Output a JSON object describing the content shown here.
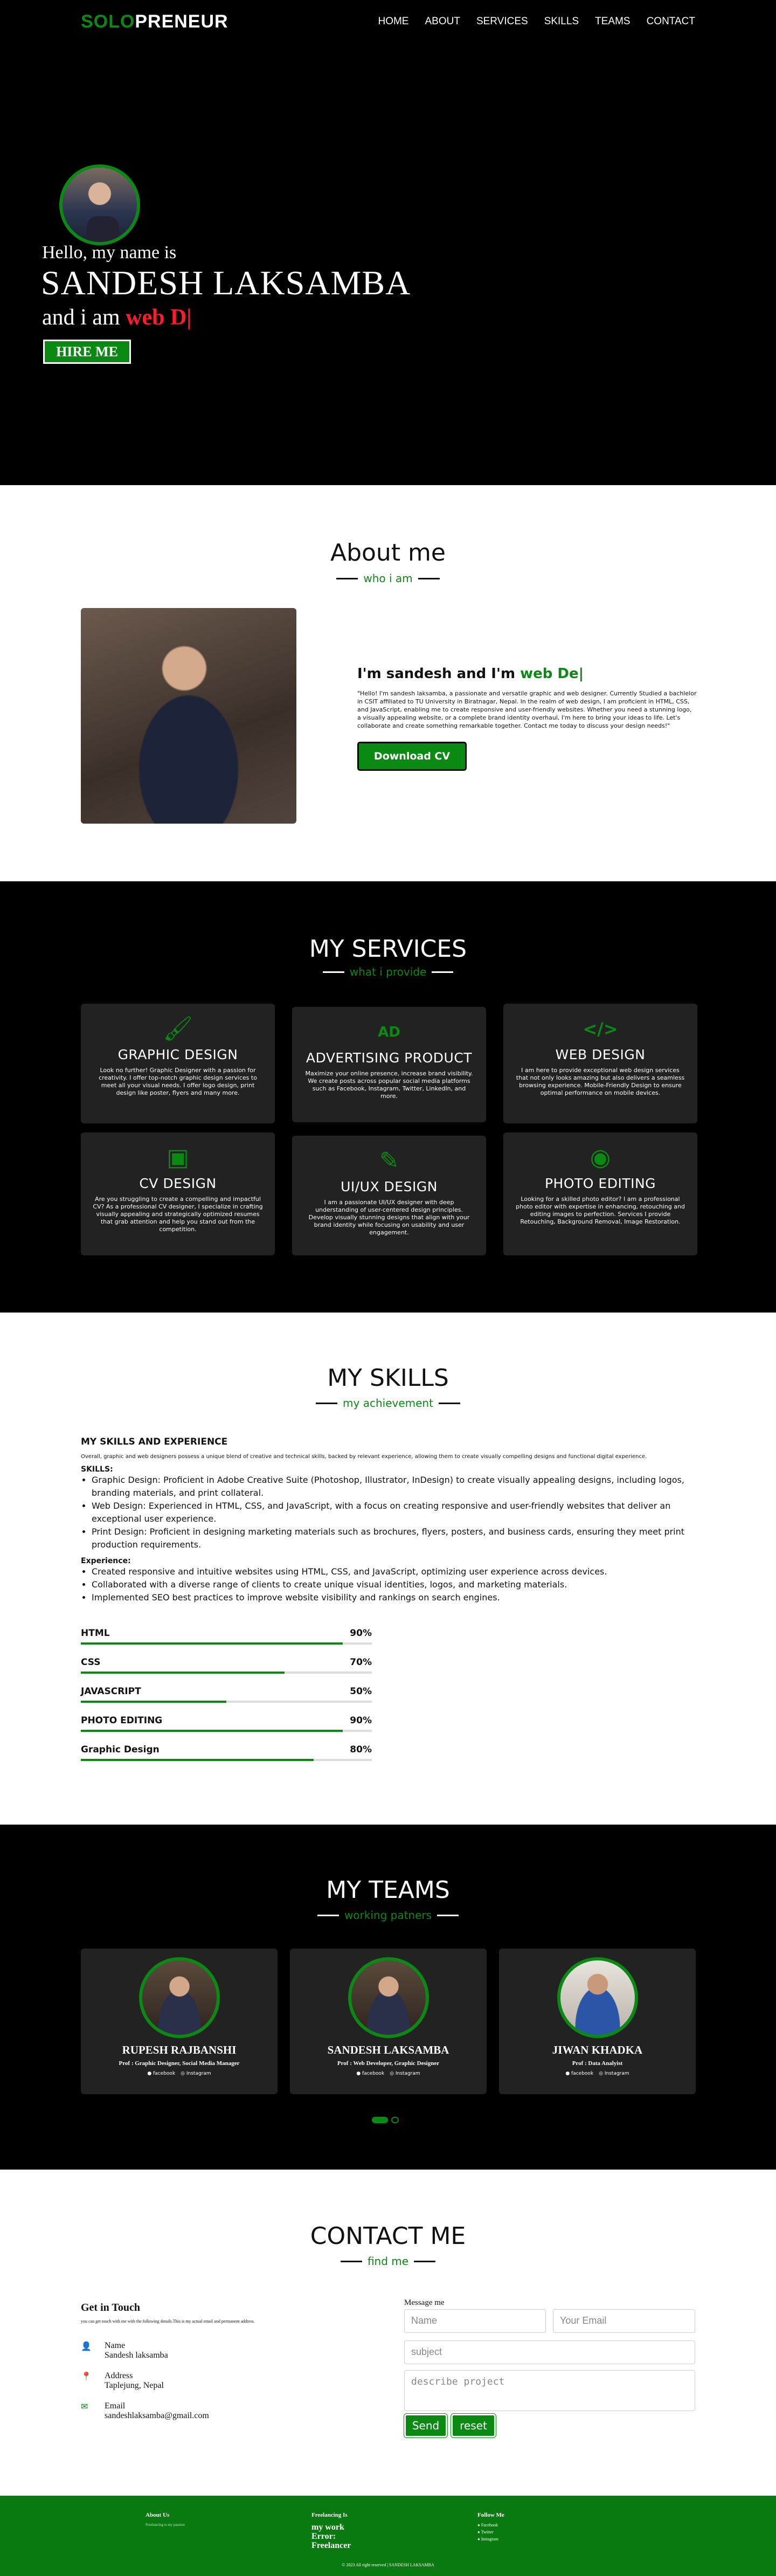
{
  "nav": {
    "logo_a": "SOLO",
    "logo_b": "PRENEUR",
    "items": [
      "HOME",
      "ABOUT",
      "SERVICES",
      "SKILLS",
      "TEAMS",
      "CONTACT"
    ]
  },
  "hero": {
    "hello": "Hello, my name is",
    "name": "SANDESH LAKSAMBA",
    "iam_prefix": "and i am",
    "iam_role": "web D|",
    "hire": "HIRE ME"
  },
  "about": {
    "title": "About me",
    "subtitle": "who i am",
    "heading_prefix": "I'm sandesh and I'm",
    "heading_role": "web De|",
    "bio": "\"Hello! I'm sandesh laksamba, a passionate and versatile graphic and web designer. Currently Studied a bachlelor in CSIT affiliated to TU University in Biratnagar, Nepal. In the realm of web design, I am proficient in HTML, CSS, and JavaScript, enabling me to create responsive and user-friendly websites. Whether you need a stunning logo, a visually appealing website, or a complete brand identity overhaul, I'm here to bring your ideas to life. Let's collaborate and create something remarkable together. Contact me today to discuss your design needs!\"",
    "cv": "Download CV"
  },
  "services": {
    "title": "MY SERVICES",
    "subtitle": "what i provide",
    "cards": [
      {
        "icon": "brush-icon",
        "glyph": "🖌",
        "title": "GRAPHIC DESIGN",
        "text": "Look no further! Graphic Designer with a passion for creativity. I offer top-notch graphic design services to meet all your visual needs. I offer logo design, print design like poster, flyers and many more."
      },
      {
        "icon": "ad-icon",
        "glyph": "AD",
        "title": "ADVERTISING PRODUCT",
        "text": "Maximize your online presence, increase brand visibility. We create posts across popular social media platforms such as Facebook, Instagram, Twitter, LinkedIn, and more."
      },
      {
        "icon": "code-icon",
        "glyph": "</>",
        "title": "WEB DESIGN",
        "text": "I am here to provide exceptional web design services that not only looks amazing but also delivers a seamless browsing experience. Mobile-Friendly Design to ensure optimal performance on mobile devices."
      },
      {
        "icon": "id-card-icon",
        "glyph": "▣",
        "title": "CV DESIGN",
        "text": "Are you struggling to create a compelling and impactful CV? As a professional CV designer, I specialize in crafting visually appealing and strategically optimized resumes that grab attention and help you stand out from the competition."
      },
      {
        "icon": "pen-tool-icon",
        "glyph": "✎",
        "title": "UI/UX DESIGN",
        "text": "I am a passionate UI/UX designer with deep understanding of user-centered design principles. Develop visually stunning designs that align with your brand identity while focusing on usability and user engagement."
      },
      {
        "icon": "camera-icon",
        "glyph": "◉",
        "title": "PHOTO EDITING",
        "text": "Looking for a skilled photo editor? I am a professional photo editor with expertise in enhancing, retouching and editing images to perfection. Services I provide Retouching, Background Removal, Image Restoration."
      }
    ]
  },
  "skills": {
    "title": "MY SKILLS",
    "subtitle": "my achievement",
    "heading": "MY SKILLS AND EXPERIENCE",
    "overview": "Overall, graphic and web designers possess a unique blend of creative and technical skills, backed by relevant experience, allowing them to create visually compelling designs and functional digital experience.",
    "skills_label": "SKILLS:",
    "skills_list": [
      "Graphic Design: Proficient in Adobe Creative Suite (Photoshop, Illustrator, InDesign) to create visually appealing designs, including logos, branding materials, and print collateral.",
      "Web Design: Experienced in HTML, CSS, and JavaScript, with a focus on creating responsive and user-friendly websites that deliver an exceptional user experience.",
      "Print Design: Proficient in designing marketing materials such as brochures, flyers, posters, and business cards, ensuring they meet print production requirements."
    ],
    "experience_label": "Experience:",
    "experience_list": [
      "Created responsive and intuitive websites using HTML, CSS, and JavaScript, optimizing user experience across devices.",
      "Collaborated with a diverse range of clients to create unique visual identities, logos, and marketing materials.",
      "Implemented SEO best practices to improve website visibility and rankings on search engines."
    ],
    "bars": [
      {
        "name": "HTML",
        "label": "90%",
        "value": 90
      },
      {
        "name": "CSS",
        "label": "70%",
        "value": 70
      },
      {
        "name": "JAVASCRIPT",
        "label": "50%",
        "value": 50
      },
      {
        "name": "PHOTO EDITING",
        "label": "90%",
        "value": 90
      },
      {
        "name": "Graphic Design",
        "label": "80%",
        "value": 80
      }
    ]
  },
  "teams": {
    "title": "MY TEAMS",
    "subtitle": "working patners",
    "members": [
      {
        "name": "RUPESH RAJBANSHI",
        "role": "Prof : Graphic Designer, Social Media Manager",
        "fb": "facebook",
        "ig": "Instagram"
      },
      {
        "name": "SANDESH LAKSAMBA",
        "role": "Prof : Web Developer, Graphic Designer",
        "fb": "facebook",
        "ig": "Instagram"
      },
      {
        "name": "JIWAN KHADKA",
        "role": "Prof : Data Analyist",
        "fb": "facebook",
        "ig": "Instagram"
      }
    ]
  },
  "contact": {
    "title": "CONTACT ME",
    "subtitle": "find me",
    "get_in_touch": "Get in Touch",
    "intro": "you can get touch with me with the following details.This is my actual email and permanent address.",
    "items": [
      {
        "icon": "user-icon",
        "glyph": "👤",
        "label": "Name",
        "value": "Sandesh laksamba"
      },
      {
        "icon": "location-icon",
        "glyph": "📍",
        "label": "Address",
        "value": "Taplejung, Nepal"
      },
      {
        "icon": "email-icon",
        "glyph": "✉",
        "label": "Email",
        "value": "sandeshlaksamba@gmail.com"
      }
    ],
    "message_label": "Message me",
    "name_placeholder": "Name",
    "email_placeholder": "Your Email",
    "subject_placeholder": "subject",
    "project_placeholder": "describe project",
    "send": "Send",
    "reset": "reset"
  },
  "footer": {
    "about_title": "About Us",
    "about_text": "Freelancing is my passion",
    "freelancing_title": "Freelancing Is",
    "freelancing_lines": [
      "my work",
      "Error:",
      "Freelancer"
    ],
    "follow_title": "Follow Me",
    "follow_links": [
      "Facebook",
      "Twitter",
      "Instagram"
    ],
    "copyright": "© 2023 All right reserved | SANDESH LAKSAMBA"
  },
  "colors": {
    "accent": "#0a8a12",
    "hero_role": "#ff1a2e",
    "dark_bg": "#000000",
    "card_bg": "#222222"
  }
}
